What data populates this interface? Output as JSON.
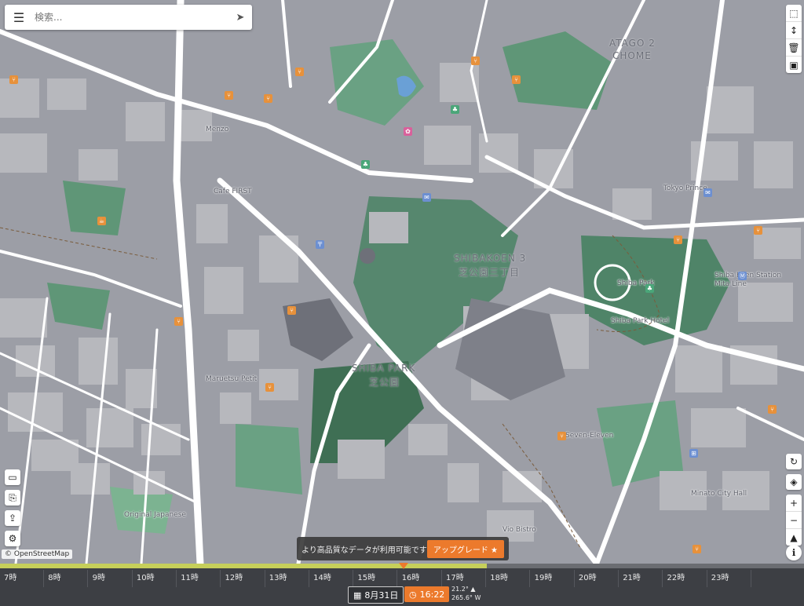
{
  "search": {
    "placeholder": "検索..."
  },
  "map_labels": [
    {
      "text": "SHIBAKOEN 3",
      "big": true
    },
    {
      "text": "芝公園三丁目",
      "big": true
    },
    {
      "text": "SHIBA PARK",
      "big": true
    },
    {
      "text": "芝公園",
      "big": true
    },
    {
      "text": "ATAGO 2",
      "big": true
    },
    {
      "text": "CHOME",
      "big": true
    },
    {
      "text": "Shiba Park",
      "big": false
    },
    {
      "text": "Cafe FIRST",
      "big": false
    },
    {
      "text": "Menzo",
      "big": false
    },
    {
      "text": "Maruetsu Petit",
      "big": false
    },
    {
      "text": "Original Japanese",
      "big": false
    },
    {
      "text": "Vio Bistro",
      "big": false
    },
    {
      "text": "Minato City Hall",
      "big": false
    },
    {
      "text": "Shiba Park Hotel",
      "big": false
    },
    {
      "text": "Seven-Eleven",
      "big": false
    },
    {
      "text": "Tokyo Prince",
      "big": false
    },
    {
      "text": "Shiba Koen Station",
      "big": false
    },
    {
      "text": "Mita Line",
      "big": false
    }
  ],
  "attribution": "© OpenStreetMap",
  "banner": {
    "text": "より高品質なデータが利用可能です",
    "button": "アップグレード ★"
  },
  "timeline": {
    "hours": [
      "7時",
      "8時",
      "9時",
      "10時",
      "11時",
      "12時",
      "13時",
      "14時",
      "15時",
      "16時",
      "17時",
      "18時",
      "19時",
      "20時",
      "21時",
      "22時",
      "23時"
    ],
    "date": "8月31日",
    "time": "16:22",
    "sun_altitude": "21.2° ▲",
    "sun_azimuth": "265.6° W",
    "progress": 0.72
  },
  "icons": {
    "menu": "menu-icon",
    "send": "navigate-icon",
    "select": "select-icon",
    "height": "height-icon",
    "trash": "trash-icon",
    "save": "save-icon",
    "folder": "folder-icon",
    "file": "file-icon",
    "share": "share-icon",
    "settings": "gear-icon",
    "rotate": "rotate-icon",
    "layers": "layers-icon",
    "zoom_in": "zoom-in-icon",
    "zoom_out": "zoom-out-icon",
    "north": "north-arrow-icon",
    "info": "info-icon",
    "calendar": "calendar-icon",
    "clock": "clock-icon"
  },
  "colors": {
    "accent": "#ec7a2c",
    "park": "#5a8a6b",
    "building": "#8a8c94",
    "road": "#ffffff",
    "timeline": "#3d3f44",
    "day_bar": "#c6cf5a"
  }
}
